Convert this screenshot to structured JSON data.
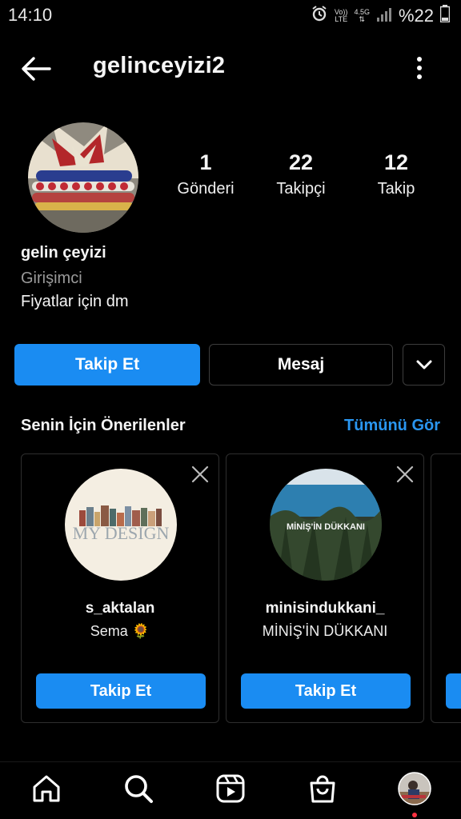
{
  "status_bar": {
    "time": "14:10",
    "network_top": "Vo))",
    "network_bottom": "LTE",
    "network_gen": "4.5G",
    "battery": "%22"
  },
  "header": {
    "username": "gelinceyizi2"
  },
  "profile": {
    "stats": [
      {
        "value": "1",
        "label": "Gönderi"
      },
      {
        "value": "22",
        "label": "Takipçi"
      },
      {
        "value": "12",
        "label": "Takip"
      }
    ],
    "name": "gelin çeyizi",
    "category": "Girişimci",
    "bio": "Fiyatlar için dm"
  },
  "actions": {
    "follow_label": "Takip Et",
    "message_label": "Mesaj"
  },
  "suggestions": {
    "title": "Senin İçin Önerilenler",
    "see_all": "Tümünü Gör",
    "cards": [
      {
        "username": "s_aktalan",
        "subtitle": "Sema 🌻",
        "avatar_text": "MY DESIGN",
        "button": "Takip Et"
      },
      {
        "username": "minisindukkani_",
        "subtitle": "MİNİŞ'İN DÜKKANI",
        "avatar_text": "MİNİŞ'İN DÜKKANI",
        "button": "Takip Et"
      }
    ]
  },
  "colors": {
    "accent": "#1a8cf2",
    "link": "#2a96f0",
    "background": "#000000",
    "notification_dot": "#ff3040"
  },
  "bottom_nav": [
    "home-icon",
    "search-icon",
    "reels-icon",
    "shop-icon",
    "profile-avatar"
  ]
}
